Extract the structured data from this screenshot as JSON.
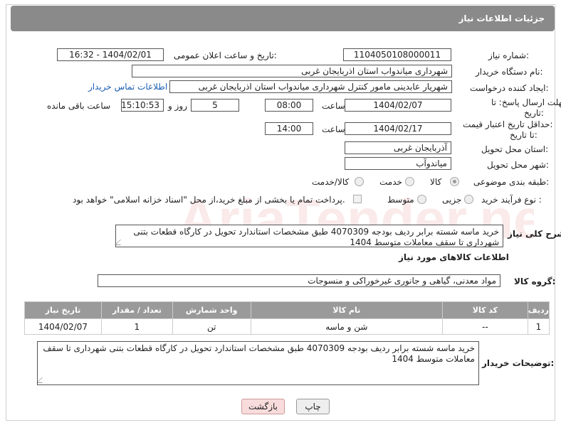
{
  "header": {
    "title": "جزئیات اطلاعات نیاز"
  },
  "fields": {
    "need_number_label": "شماره نیاز:",
    "need_number": "1104050108000011",
    "announce_label": "تاریخ و ساعت اعلان عمومی:",
    "announce_value": "1404/02/01 - 16:32",
    "buyer_label": "نام دستگاه خریدار:",
    "buyer_value": "شهرداری میاندواب استان اذربایجان غربی",
    "creator_label": "ایجاد کننده درخواست:",
    "creator_value": "شهریار  عابدینی مامور کنترل شهرداری میاندواب استان اذربایجان غربی",
    "contact_link": "اطلاعات تماس خریدار",
    "deadline_label_1": "مهلت ارسال پاسخ: تا",
    "deadline_label_2": "تاریخ:",
    "deadline_date": "1404/02/07",
    "time_label": "ساعت",
    "deadline_time": "08:00",
    "days_value": "5",
    "days_label": "روز و",
    "remaining_time": "15:10:53",
    "remaining_label": "ساعت باقی مانده",
    "price_label_1": "حداقل تاریخ اعتبار قیمت:",
    "price_label_2": "تا تاریخ:",
    "price_date": "1404/02/17",
    "price_time": "14:00",
    "province_label": "استان محل تحویل:",
    "province_value": "آذربایجان غربی",
    "city_label": "شهر محل تحویل:",
    "city_value": "میاندوآب",
    "category_label": "طبقه بندی موضوعی:",
    "cat_goods": "کالا",
    "cat_service": "خدمت",
    "cat_goods_service": "کالا/خدمت",
    "process_label": "نوع فرآیند خرید :",
    "proc_partial": "جزیی",
    "proc_medium": "متوسط",
    "payment_note": "پرداخت تمام یا بخشی از مبلغ خرید،از محل \"اسناد خزانه اسلامی\" خواهد بود."
  },
  "summary": {
    "label": "شرح کلی نیاز:",
    "text": "خرید ماسه شسته برابر ردیف بودجه 4070309 طبق مشخصات استاندارد تحویل در کارگاه قطعات بتنی شهرداری تا سقف معاملات متوسط 1404"
  },
  "goods_section": {
    "title": "اطلاعات کالاهای مورد نیاز",
    "group_label": "گروه کالا:",
    "group_value": "مواد معدنی، گیاهی و جانوری غیرخوراکی و منسوجات"
  },
  "table": {
    "headers": [
      "ردیف",
      "کد کالا",
      "نام کالا",
      "واحد شمارش",
      "تعداد / مقدار",
      "تاریخ نیاز"
    ],
    "rows": [
      [
        "1",
        "--",
        "شن و ماسه",
        "تن",
        "1",
        "1404/02/07"
      ]
    ]
  },
  "buyer_notes": {
    "label": "توضیحات خریدار:",
    "text": "خرید ماسه شسته برابر ردیف بودجه 4070309 طبق مشخصات استاندارد تحویل در کارگاه قطعات بتنی شهرداری تا سقف معاملات متوسط 1404"
  },
  "buttons": {
    "print": "چاپ",
    "back": "بازگشت"
  },
  "watermark": "AriaTender.net"
}
